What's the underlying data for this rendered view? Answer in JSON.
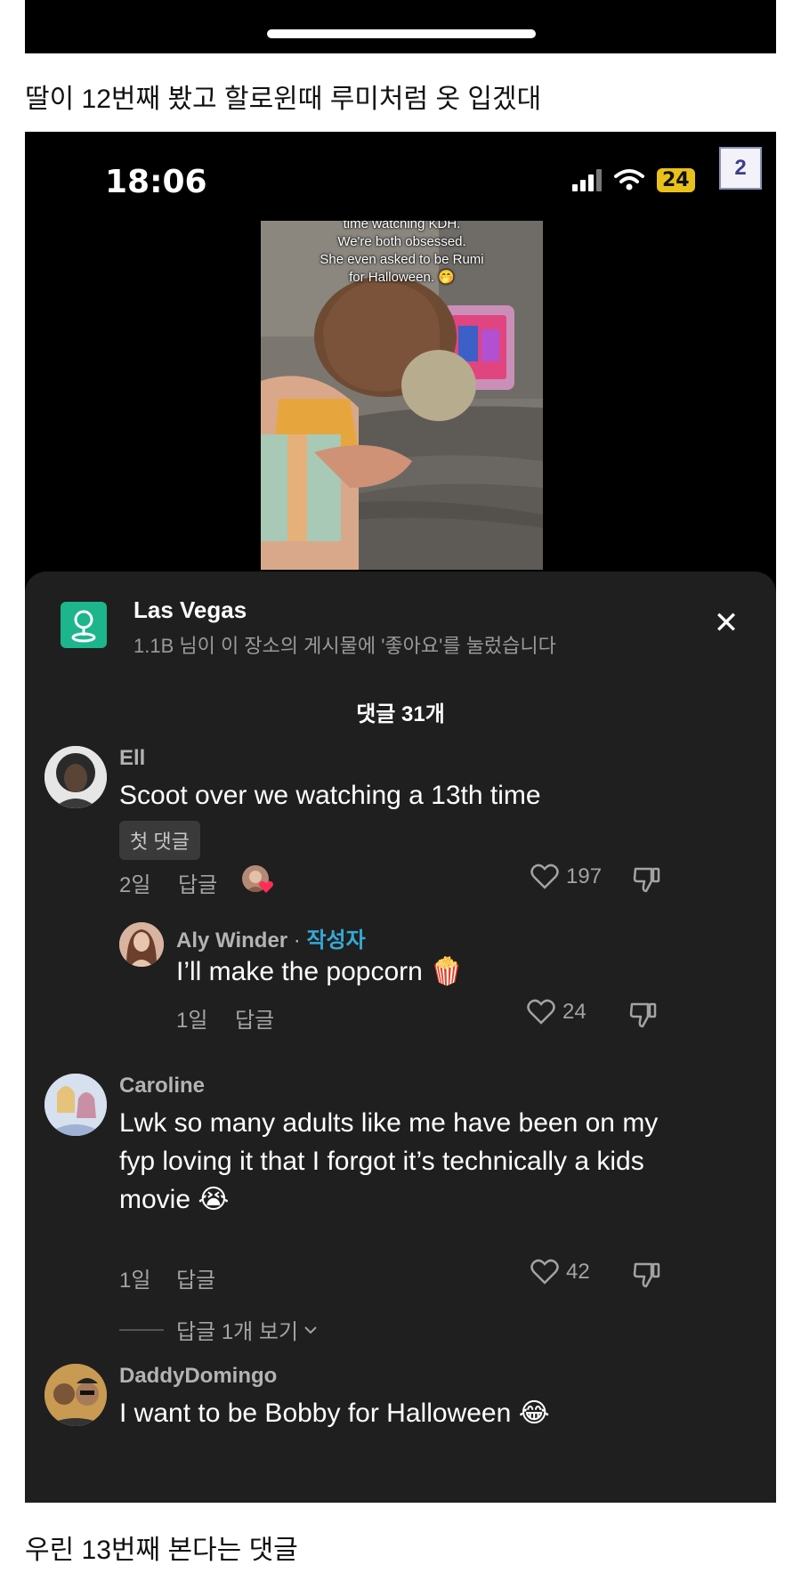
{
  "post": {
    "caption_top": "딸이 12번째 봤고 할로윈때 루미처럼 옷 입겠대",
    "caption_bottom": "우린 13번째 본다는 댓글"
  },
  "status_bar": {
    "time": "18:06",
    "battery": "24",
    "page_badge": "2"
  },
  "video": {
    "overlay_cut": "time watching KDH.",
    "overlay_line1": "We're both obsessed.",
    "overlay_line2": "She even asked to be Rumi",
    "overlay_line3": "for Halloween. 🤭"
  },
  "sheet": {
    "location_title": "Las Vegas",
    "location_subtitle": "1.1B 님이 이 장소의 게시물에 '좋아요'를 눌렀습니다",
    "close_icon": "✕",
    "comments_count": "댓글 31개",
    "reply_label": "답글",
    "view_replies": "답글 1개 보기"
  },
  "comments": [
    {
      "author": "Ell",
      "text": "Scoot over we watching a 13th time",
      "badge": "첫 댓글",
      "time": "2일",
      "likes": "197"
    },
    {
      "author": "Aly Winder",
      "separator": " · ",
      "creator_label": "작성자",
      "text": "I’ll make the popcorn 🍿",
      "time": "1일",
      "likes": "24"
    },
    {
      "author": "Caroline",
      "text": "Lwk so many adults like me have been on my fyp loving it that I forgot it’s technically a kids movie 😭",
      "time": "1일",
      "likes": "42"
    },
    {
      "author": "DaddyDomingo",
      "text": "I want to be Bobby for Halloween 😂"
    }
  ],
  "icons": {
    "location": "location-pin-icon",
    "like": "heart-outline-icon",
    "dislike": "thumbs-down-icon",
    "chevron": "chevron-down-icon"
  },
  "colors": {
    "sheet_bg": "#1f1f1f",
    "creator_accent": "#36a9d6",
    "location_icon_bg": "#1db58c",
    "battery": "#e8c21a"
  }
}
